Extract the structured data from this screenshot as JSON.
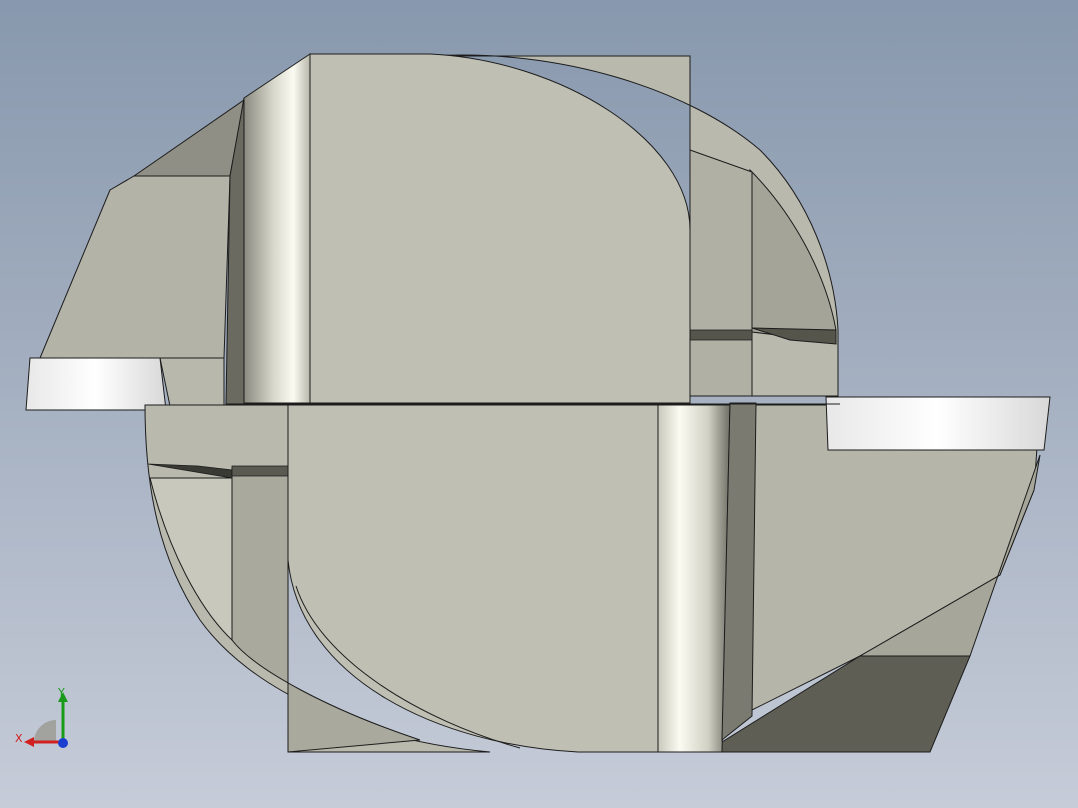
{
  "viewport": {
    "background_top": "#8898ad",
    "background_bottom": "#c6ccd8"
  },
  "model": {
    "face_colors": {
      "light": "#bfbfb4",
      "mid": "#a8a89c",
      "dark": "#5f5f55",
      "insert": "#ffffff",
      "edge": "#1c1c1c"
    }
  },
  "triad": {
    "x_label": "X",
    "y_label": "Y",
    "x_color": "#d02020",
    "y_color": "#1a9a1a",
    "z_color": "#1a3fd0",
    "icon": "coordinate-triad-icon"
  }
}
